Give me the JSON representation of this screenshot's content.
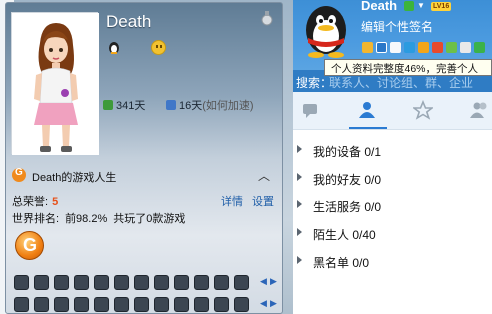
{
  "profile_card": {
    "nickname": "Death",
    "online_days": "341天",
    "active_days": "16天",
    "speedup_hint": "(如何加速)",
    "game_section": {
      "title": "Death的游戏人生",
      "honor_label": "总荣誉:",
      "honor_value": "5",
      "detail_link": "详情",
      "settings_link": "设置",
      "rank_label": "世界排名:",
      "rank_value": "前98.2%",
      "played_text": "共玩了0款游戏"
    }
  },
  "main_panel": {
    "nickname": "Death",
    "level_badge": "LV16",
    "signature_placeholder": "编辑个性签名",
    "tooltip": "个人资料完整度46%，完善个人",
    "search_label": "搜索：",
    "search_hint": "联系人、讨论组、群、企业",
    "groups": [
      {
        "name": "我的设备",
        "count": "0/1"
      },
      {
        "name": "我的好友",
        "count": "0/0"
      },
      {
        "name": "生活服务",
        "count": "0/0"
      },
      {
        "name": "陌生人",
        "count": "0/40"
      },
      {
        "name": "黑名单",
        "count": "0/0"
      }
    ]
  },
  "colors": {
    "accent": "#2b7bd2",
    "honor": "#e6511a",
    "link": "#1f5ea8"
  }
}
